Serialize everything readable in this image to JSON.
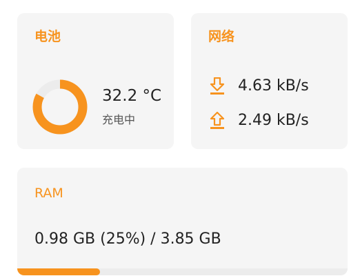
{
  "colors": {
    "accent": "#f7931e",
    "card_bg": "#f5f5f5",
    "track": "#ececec",
    "text": "#222222",
    "subtext": "#555555"
  },
  "battery": {
    "title": "电池",
    "level_fraction": 0.83,
    "temperature": "32.2 °C",
    "status": "充电中"
  },
  "network": {
    "title": "网络",
    "download_icon": "download-arrow-icon",
    "download": "4.63 kB/s",
    "upload_icon": "upload-arrow-icon",
    "upload": "2.49 kB/s"
  },
  "ram": {
    "title": "RAM",
    "usage": "0.98 GB (25%) / 3.85 GB",
    "used_fraction": 0.25
  }
}
